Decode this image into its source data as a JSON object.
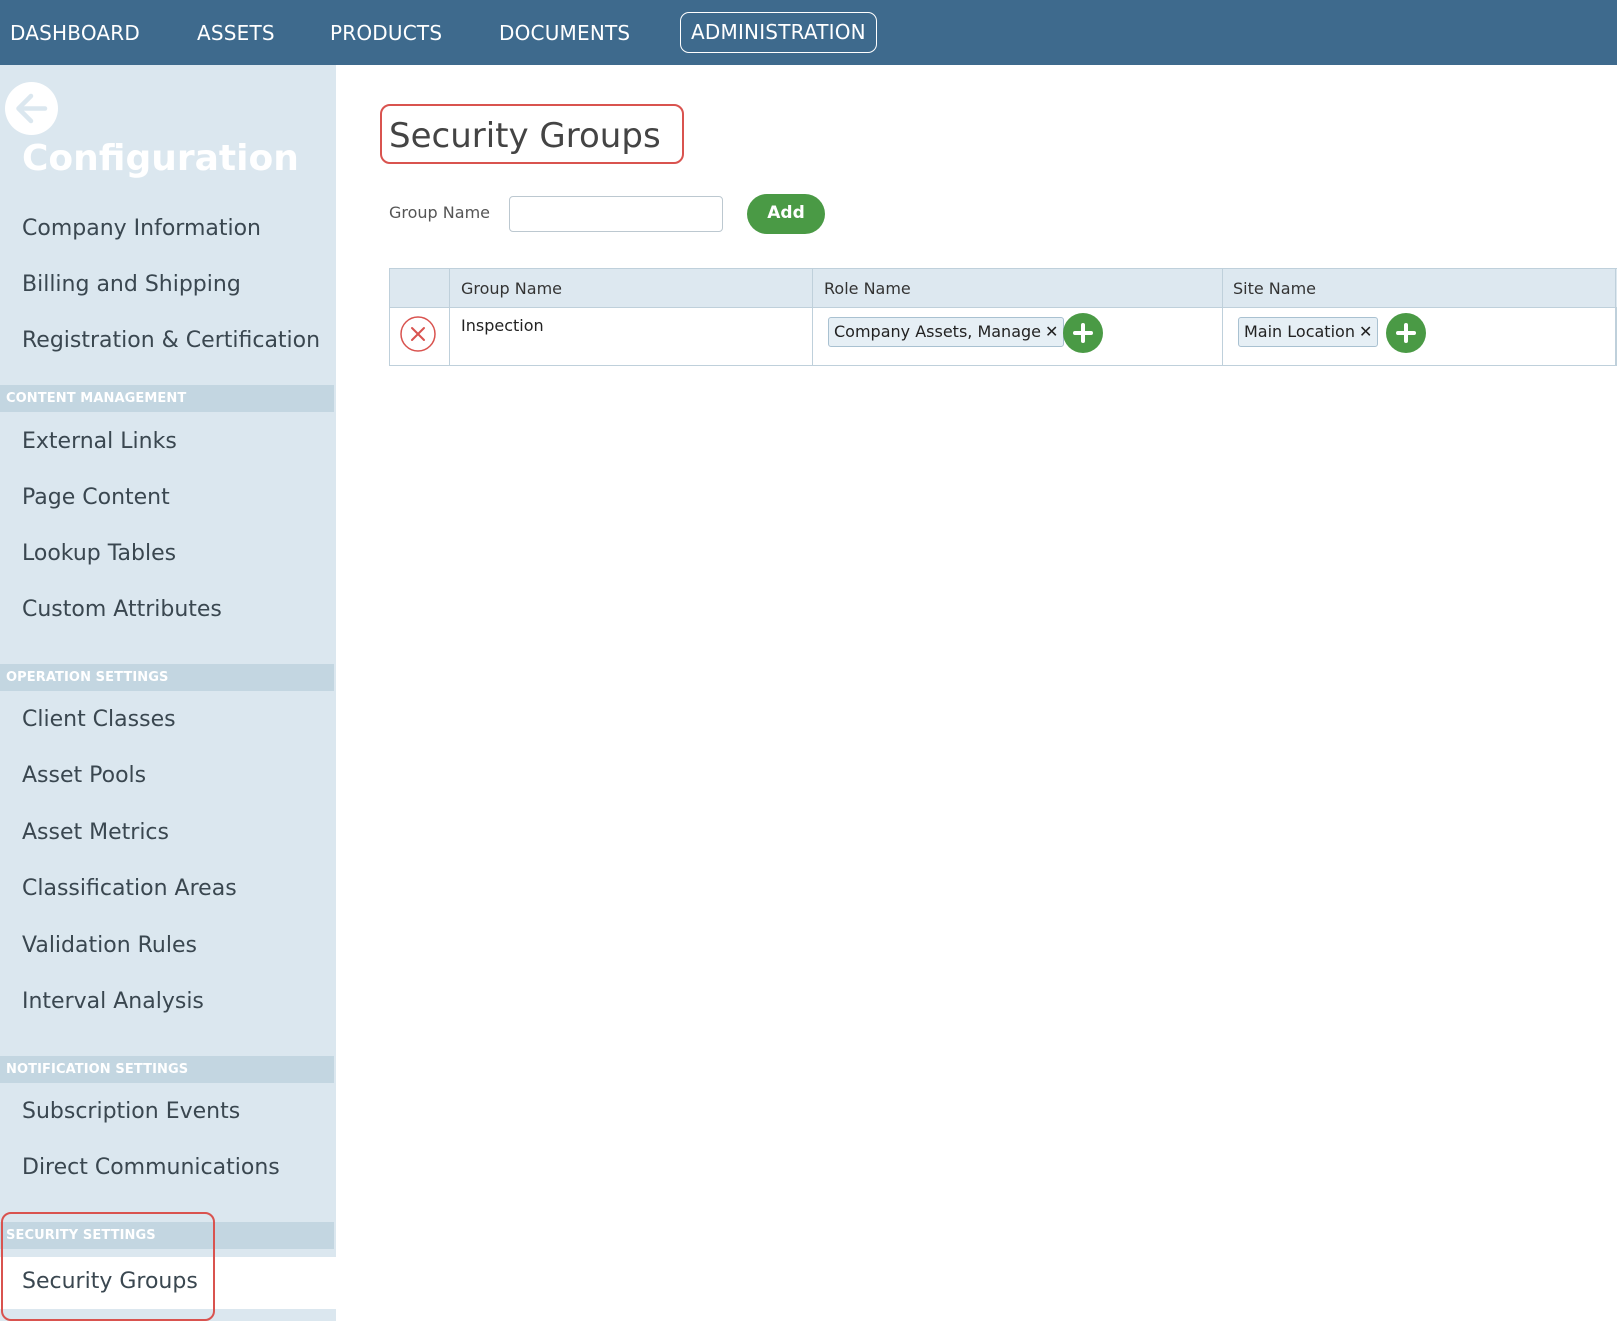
{
  "topnav": {
    "items": [
      {
        "label": "DASHBOARD"
      },
      {
        "label": "ASSETS"
      },
      {
        "label": "PRODUCTS"
      },
      {
        "label": "DOCUMENTS"
      },
      {
        "label": "ADMINISTRATION",
        "active": true
      }
    ],
    "background": "#3e6a8d"
  },
  "sidebar": {
    "title": "Configuration",
    "items": [
      {
        "label": "Company Information"
      },
      {
        "label": "Billing and Shipping"
      },
      {
        "label": "Registration & Certification"
      }
    ],
    "sections": [
      {
        "header": "CONTENT MANAGEMENT",
        "items": [
          {
            "label": "External Links"
          },
          {
            "label": "Page Content"
          },
          {
            "label": "Lookup Tables"
          },
          {
            "label": "Custom Attributes"
          }
        ]
      },
      {
        "header": "OPERATION SETTINGS",
        "items": [
          {
            "label": "Client Classes"
          },
          {
            "label": "Asset Pools"
          },
          {
            "label": "Asset Metrics"
          },
          {
            "label": "Classification Areas"
          },
          {
            "label": "Validation Rules"
          },
          {
            "label": "Interval Analysis"
          }
        ]
      },
      {
        "header": "NOTIFICATION SETTINGS",
        "items": [
          {
            "label": "Subscription Events"
          },
          {
            "label": "Direct Communications"
          }
        ]
      },
      {
        "header": "SECURITY SETTINGS",
        "items": [
          {
            "label": "Security Groups",
            "active": true
          }
        ]
      }
    ]
  },
  "main": {
    "title": "Security Groups",
    "form": {
      "group_name_label": "Group Name",
      "group_name_value": "",
      "add_label": "Add"
    },
    "table": {
      "columns": [
        "Group Name",
        "Role Name",
        "Site Name"
      ],
      "rows": [
        {
          "group_name": "Inspection",
          "roles": [
            "Company Assets, Manage"
          ],
          "sites": [
            "Main Location"
          ]
        }
      ]
    }
  },
  "colors": {
    "accent_green": "#4a9a45",
    "delete_red": "#d9534f",
    "highlight": "#d9534f",
    "sidebar_bg": "#dbe7ef"
  }
}
